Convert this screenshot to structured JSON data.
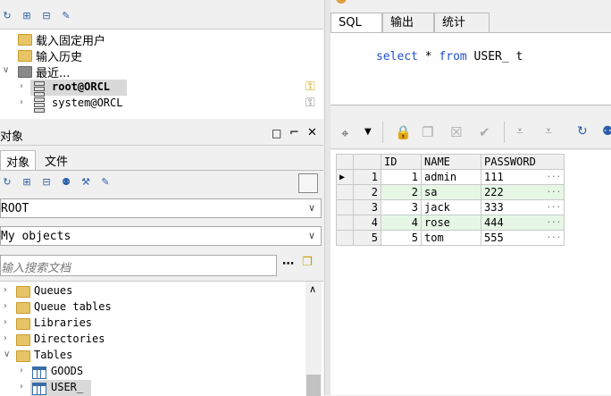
{
  "connections": {
    "tree": [
      {
        "label": "载入固定用户",
        "type": "folder"
      },
      {
        "label": "输入历史",
        "type": "folder"
      },
      {
        "label": "最近...",
        "type": "folder-open"
      },
      {
        "label": "root@ORCL",
        "type": "db",
        "selected": true
      },
      {
        "label": "system@ORCL",
        "type": "db"
      }
    ]
  },
  "object_panel": {
    "title": "对象",
    "tabs": [
      "对象",
      "文件"
    ],
    "owner_value": "ROOT",
    "filter_value": "My objects",
    "search_placeholder": "输入搜索文档",
    "tree": [
      "Queues",
      "Queue tables",
      "Libraries",
      "Directories",
      "Tables",
      "GOODS",
      "USER_"
    ]
  },
  "editor": {
    "tabs": [
      "SQL",
      "输出",
      "统计"
    ],
    "sql_tokens": [
      "select",
      " * ",
      "from",
      " USER_ t"
    ]
  },
  "result": {
    "columns": [
      "ID",
      "NAME",
      "PASSWORD"
    ],
    "rows": [
      {
        "rownum": "1",
        "id": "1",
        "name": "admin",
        "password": "111"
      },
      {
        "rownum": "2",
        "id": "2",
        "name": "sa",
        "password": "222"
      },
      {
        "rownum": "3",
        "id": "3",
        "name": "jack",
        "password": "333"
      },
      {
        "rownum": "4",
        "id": "4",
        "name": "rose",
        "password": "444"
      },
      {
        "rownum": "5",
        "id": "5",
        "name": "tom",
        "password": "555"
      }
    ],
    "ellipsis": "..."
  },
  "colors": {
    "even_row": "#e6f7e6",
    "sql_keyword": "#1f4fd0",
    "selected_bg": "#d9d9d9"
  }
}
